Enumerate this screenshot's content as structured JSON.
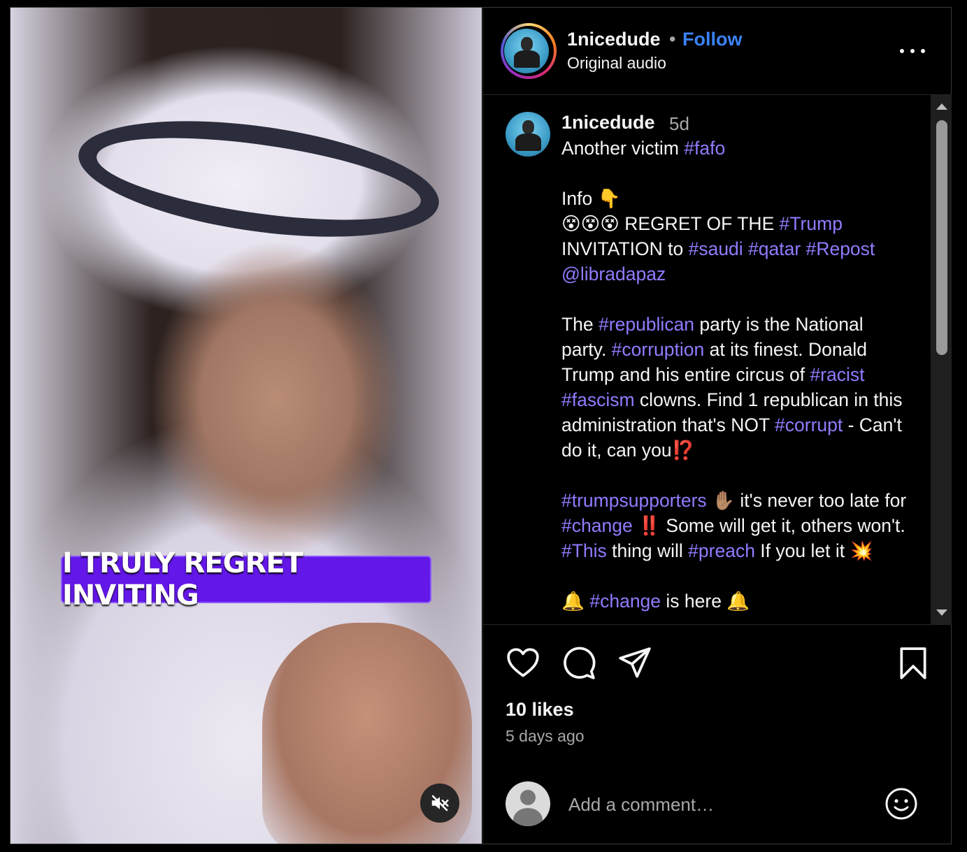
{
  "video": {
    "caption": "I TRULY REGRET INVITING",
    "mute_icon": "speaker-muted-icon"
  },
  "header": {
    "username": "1nicedude",
    "separator": "•",
    "follow_label": "Follow",
    "audio_label": "Original audio",
    "more_icon": "more-options-icon"
  },
  "post": {
    "username": "1nicedude",
    "time": "5d",
    "line1_text": "Another victim ",
    "line1_tag": "#fafo",
    "info_label": "Info 👇",
    "p2_emojis": "😵😵😵",
    "p2_t1": " REGRET OF THE ",
    "p2_tag1": "#Trump",
    "p2_t2": " INVITATION to ",
    "p2_tag2": "#saudi",
    "p2_tag3": "#qatar",
    "p2_tag4": "#Repost",
    "p2_mention": "@libradapaz",
    "p3_t1": "The ",
    "p3_tag1": "#republican",
    "p3_t2": " party is the National party. ",
    "p3_tag2": "#corruption",
    "p3_t3": " at its finest. Donald Trump and his entire circus of ",
    "p3_tag3": "#racist",
    "p3_tag4": "#fascism",
    "p3_t4": " clowns. Find 1 republican in this administration that's NOT ",
    "p3_tag5": "#corrupt",
    "p3_t5": " - Can't do it, can you⁉️",
    "p4_tag1": "#trumpsupporters",
    "p4_t1": " ✋🏽 it's never too late for ",
    "p4_tag2": "#change",
    "p4_t2": " ‼️ Some will get it, others won't. ",
    "p4_tag3": "#This",
    "p4_t3": " thing will ",
    "p4_tag4": "#preach",
    "p4_t4": " If you let it 💥",
    "p5_t1": "🔔 ",
    "p5_tag1": "#change",
    "p5_t2": " is here 🔔"
  },
  "actions": {
    "like_icon": "heart-icon",
    "comment_icon": "comment-icon",
    "share_icon": "share-icon",
    "save_icon": "bookmark-icon",
    "likes": "10 likes",
    "posted": "5 days ago"
  },
  "comment_box": {
    "placeholder": "Add a comment…",
    "emoji_icon": "emoji-icon"
  },
  "colors": {
    "accent_link": "#3b82f6",
    "hashtag": "#8f7cff",
    "caption_bg": "#6317e8",
    "background": "#000000"
  }
}
